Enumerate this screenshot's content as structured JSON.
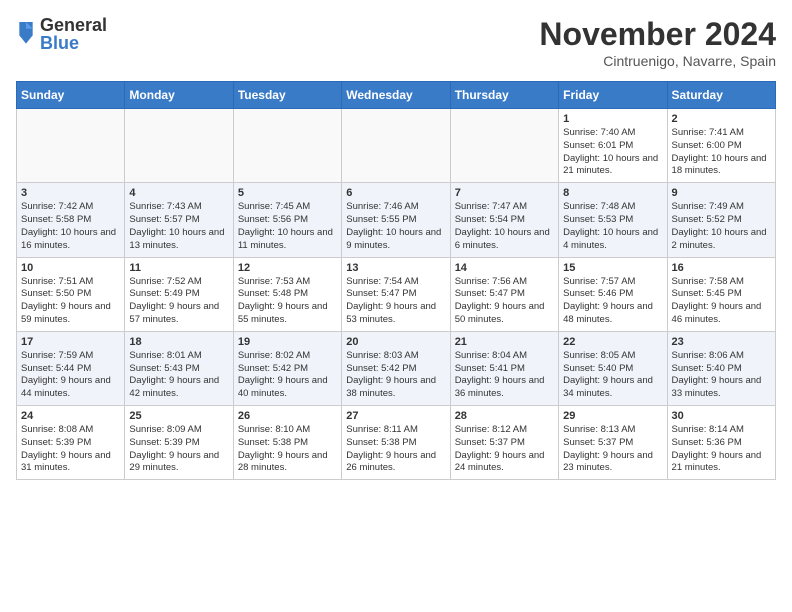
{
  "header": {
    "logo": {
      "general": "General",
      "blue": "Blue"
    },
    "title": "November 2024",
    "location": "Cintruenigo, Navarre, Spain"
  },
  "days_of_week": [
    "Sunday",
    "Monday",
    "Tuesday",
    "Wednesday",
    "Thursday",
    "Friday",
    "Saturday"
  ],
  "weeks": [
    [
      {
        "day": "",
        "info": ""
      },
      {
        "day": "",
        "info": ""
      },
      {
        "day": "",
        "info": ""
      },
      {
        "day": "",
        "info": ""
      },
      {
        "day": "",
        "info": ""
      },
      {
        "day": "1",
        "info": "Sunrise: 7:40 AM\nSunset: 6:01 PM\nDaylight: 10 hours and 21 minutes."
      },
      {
        "day": "2",
        "info": "Sunrise: 7:41 AM\nSunset: 6:00 PM\nDaylight: 10 hours and 18 minutes."
      }
    ],
    [
      {
        "day": "3",
        "info": "Sunrise: 7:42 AM\nSunset: 5:58 PM\nDaylight: 10 hours and 16 minutes."
      },
      {
        "day": "4",
        "info": "Sunrise: 7:43 AM\nSunset: 5:57 PM\nDaylight: 10 hours and 13 minutes."
      },
      {
        "day": "5",
        "info": "Sunrise: 7:45 AM\nSunset: 5:56 PM\nDaylight: 10 hours and 11 minutes."
      },
      {
        "day": "6",
        "info": "Sunrise: 7:46 AM\nSunset: 5:55 PM\nDaylight: 10 hours and 9 minutes."
      },
      {
        "day": "7",
        "info": "Sunrise: 7:47 AM\nSunset: 5:54 PM\nDaylight: 10 hours and 6 minutes."
      },
      {
        "day": "8",
        "info": "Sunrise: 7:48 AM\nSunset: 5:53 PM\nDaylight: 10 hours and 4 minutes."
      },
      {
        "day": "9",
        "info": "Sunrise: 7:49 AM\nSunset: 5:52 PM\nDaylight: 10 hours and 2 minutes."
      }
    ],
    [
      {
        "day": "10",
        "info": "Sunrise: 7:51 AM\nSunset: 5:50 PM\nDaylight: 9 hours and 59 minutes."
      },
      {
        "day": "11",
        "info": "Sunrise: 7:52 AM\nSunset: 5:49 PM\nDaylight: 9 hours and 57 minutes."
      },
      {
        "day": "12",
        "info": "Sunrise: 7:53 AM\nSunset: 5:48 PM\nDaylight: 9 hours and 55 minutes."
      },
      {
        "day": "13",
        "info": "Sunrise: 7:54 AM\nSunset: 5:47 PM\nDaylight: 9 hours and 53 minutes."
      },
      {
        "day": "14",
        "info": "Sunrise: 7:56 AM\nSunset: 5:47 PM\nDaylight: 9 hours and 50 minutes."
      },
      {
        "day": "15",
        "info": "Sunrise: 7:57 AM\nSunset: 5:46 PM\nDaylight: 9 hours and 48 minutes."
      },
      {
        "day": "16",
        "info": "Sunrise: 7:58 AM\nSunset: 5:45 PM\nDaylight: 9 hours and 46 minutes."
      }
    ],
    [
      {
        "day": "17",
        "info": "Sunrise: 7:59 AM\nSunset: 5:44 PM\nDaylight: 9 hours and 44 minutes."
      },
      {
        "day": "18",
        "info": "Sunrise: 8:01 AM\nSunset: 5:43 PM\nDaylight: 9 hours and 42 minutes."
      },
      {
        "day": "19",
        "info": "Sunrise: 8:02 AM\nSunset: 5:42 PM\nDaylight: 9 hours and 40 minutes."
      },
      {
        "day": "20",
        "info": "Sunrise: 8:03 AM\nSunset: 5:42 PM\nDaylight: 9 hours and 38 minutes."
      },
      {
        "day": "21",
        "info": "Sunrise: 8:04 AM\nSunset: 5:41 PM\nDaylight: 9 hours and 36 minutes."
      },
      {
        "day": "22",
        "info": "Sunrise: 8:05 AM\nSunset: 5:40 PM\nDaylight: 9 hours and 34 minutes."
      },
      {
        "day": "23",
        "info": "Sunrise: 8:06 AM\nSunset: 5:40 PM\nDaylight: 9 hours and 33 minutes."
      }
    ],
    [
      {
        "day": "24",
        "info": "Sunrise: 8:08 AM\nSunset: 5:39 PM\nDaylight: 9 hours and 31 minutes."
      },
      {
        "day": "25",
        "info": "Sunrise: 8:09 AM\nSunset: 5:39 PM\nDaylight: 9 hours and 29 minutes."
      },
      {
        "day": "26",
        "info": "Sunrise: 8:10 AM\nSunset: 5:38 PM\nDaylight: 9 hours and 28 minutes."
      },
      {
        "day": "27",
        "info": "Sunrise: 8:11 AM\nSunset: 5:38 PM\nDaylight: 9 hours and 26 minutes."
      },
      {
        "day": "28",
        "info": "Sunrise: 8:12 AM\nSunset: 5:37 PM\nDaylight: 9 hours and 24 minutes."
      },
      {
        "day": "29",
        "info": "Sunrise: 8:13 AM\nSunset: 5:37 PM\nDaylight: 9 hours and 23 minutes."
      },
      {
        "day": "30",
        "info": "Sunrise: 8:14 AM\nSunset: 5:36 PM\nDaylight: 9 hours and 21 minutes."
      }
    ]
  ]
}
